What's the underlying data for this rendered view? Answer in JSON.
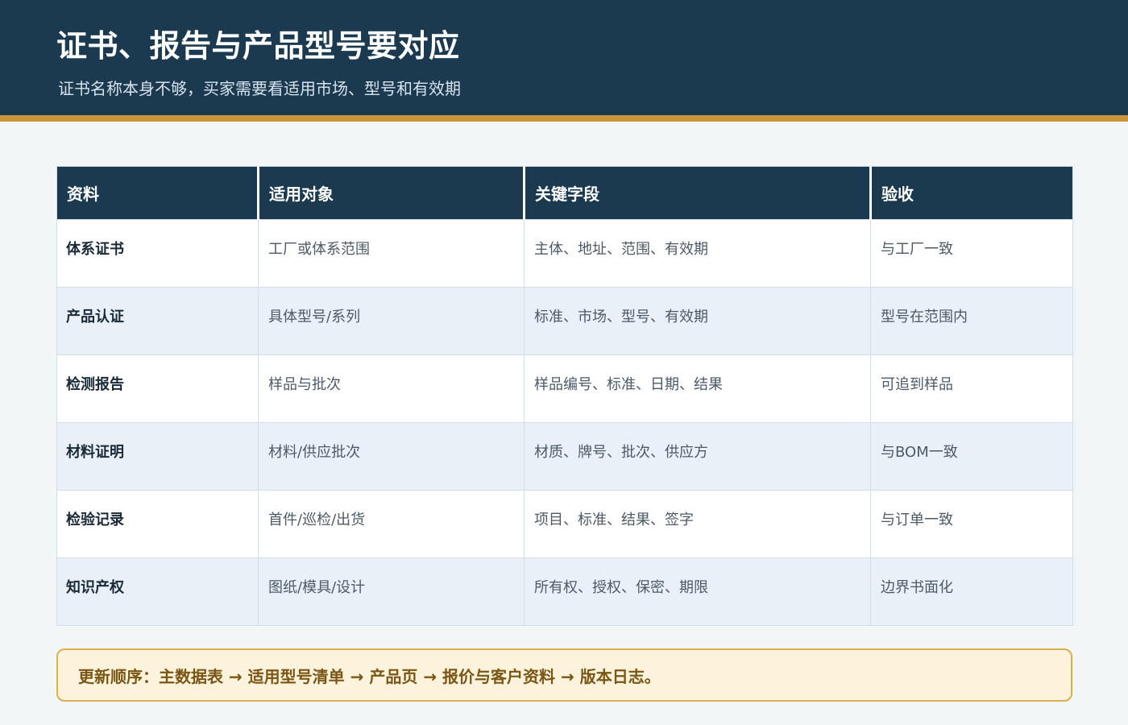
{
  "header": {
    "title": "证书、报告与产品型号要对应",
    "subtitle": "证书名称本身不够，买家需要看适用市场、型号和有效期"
  },
  "table": {
    "columns": [
      "资料",
      "适用对象",
      "关键字段",
      "验收"
    ],
    "rows": [
      [
        "体系证书",
        "工厂或体系范围",
        "主体、地址、范围、有效期",
        "与工厂一致"
      ],
      [
        "产品认证",
        "具体型号/系列",
        "标准、市场、型号、有效期",
        "型号在范围内"
      ],
      [
        "检测报告",
        "样品与批次",
        "样品编号、标准、日期、结果",
        "可追到样品"
      ],
      [
        "材料证明",
        "材料/供应批次",
        "材质、牌号、批次、供应方",
        "与BOM一致"
      ],
      [
        "检验记录",
        "首件/巡检/出货",
        "项目、标准、结果、签字",
        "与订单一致"
      ],
      [
        "知识产权",
        "图纸/模具/设计",
        "所有权、授权、保密、期限",
        "边界书面化"
      ]
    ]
  },
  "note": {
    "text": "更新顺序：主数据表 → 适用型号清单 → 产品页 → 报价与客户资料 → 版本日志。"
  },
  "colors": {
    "header_bg": "#1b3a50",
    "accent": "#c9963c",
    "row_alt": "#e9f0f7",
    "note_bg": "#fdf3dc",
    "note_border": "#dcb04f",
    "note_text": "#7a5614"
  }
}
